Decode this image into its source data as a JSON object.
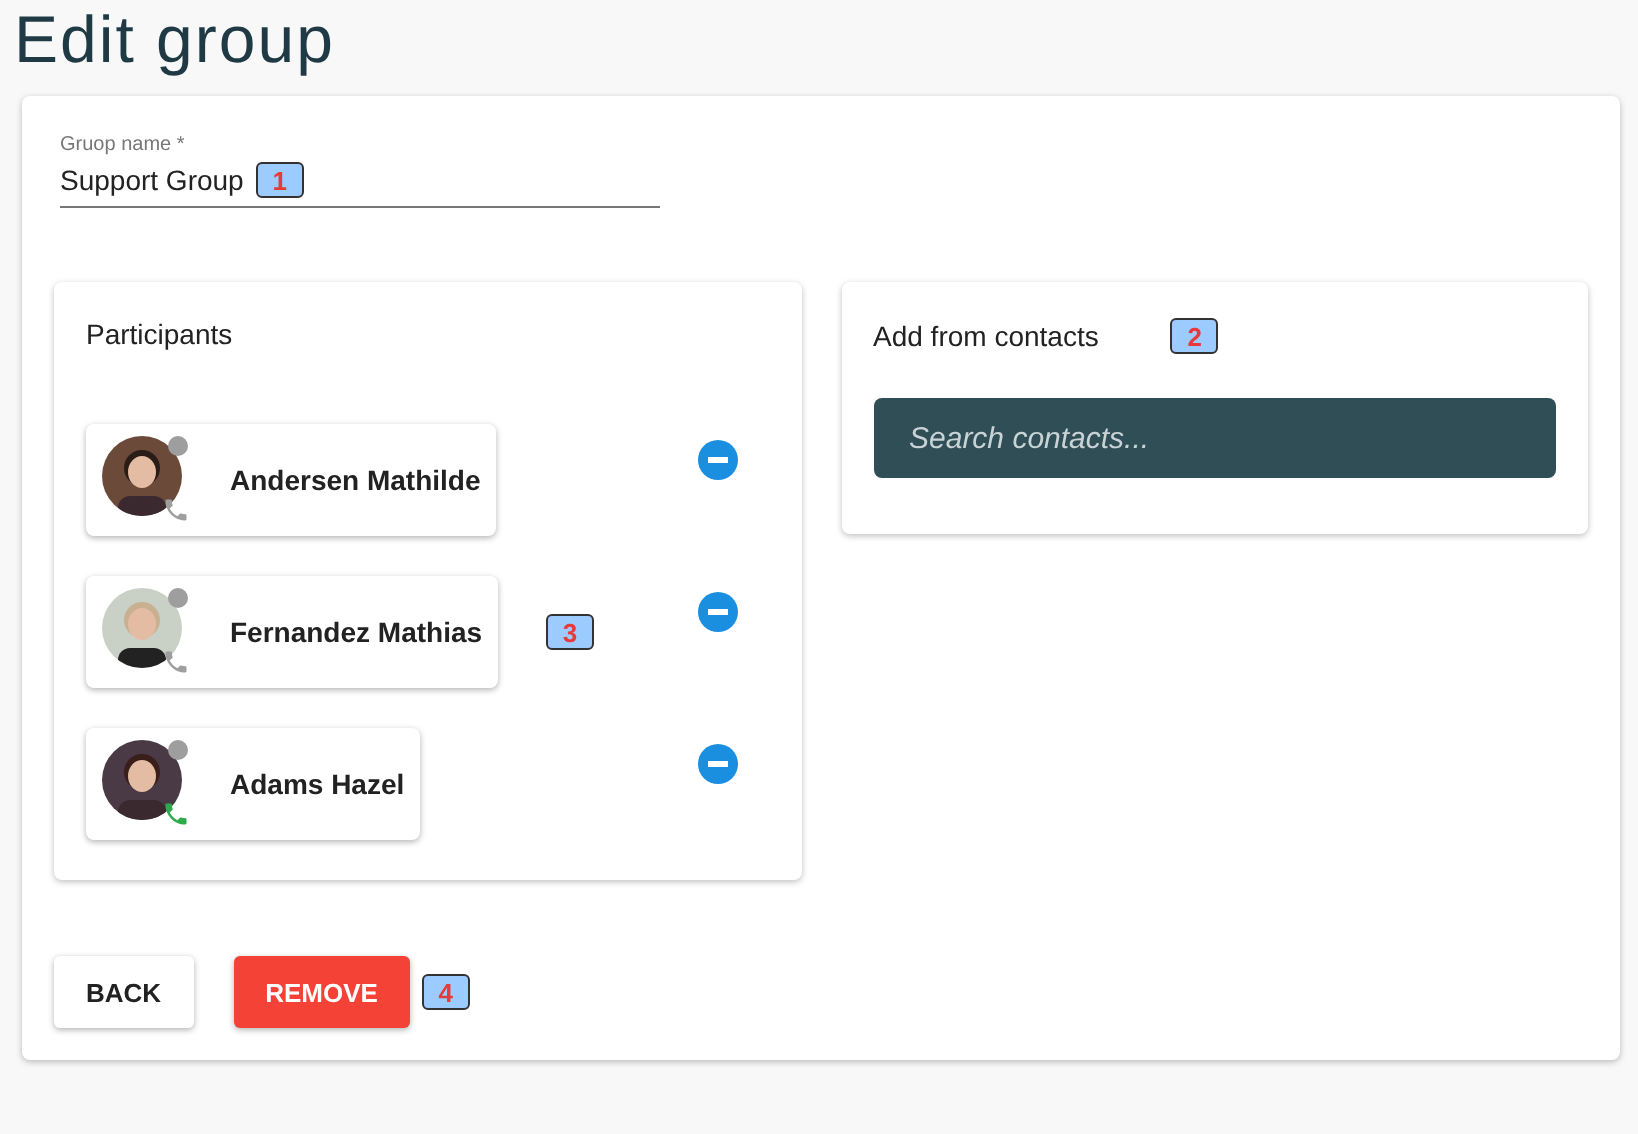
{
  "title": "Edit group",
  "group_name": {
    "label": "Gruop name *",
    "value": "Support Group",
    "callout": "1"
  },
  "participants": {
    "title": "Participants",
    "callout": "3",
    "items": [
      {
        "name": "Andersen Mathilde",
        "color": "#9e9e9e"
      },
      {
        "name": "Fernandez Mathias",
        "color": "#9e9e9e"
      },
      {
        "name": "Adams Hazel",
        "color": "#2eaa4a"
      }
    ]
  },
  "contacts": {
    "title": "Add from contacts",
    "callout": "2",
    "search": {
      "placeholder": "Search contacts..."
    }
  },
  "buttons": [
    {
      "label": "BACK",
      "kind": "secondary"
    },
    {
      "label": "REMOVE",
      "kind": "danger",
      "callout": "4"
    }
  ]
}
